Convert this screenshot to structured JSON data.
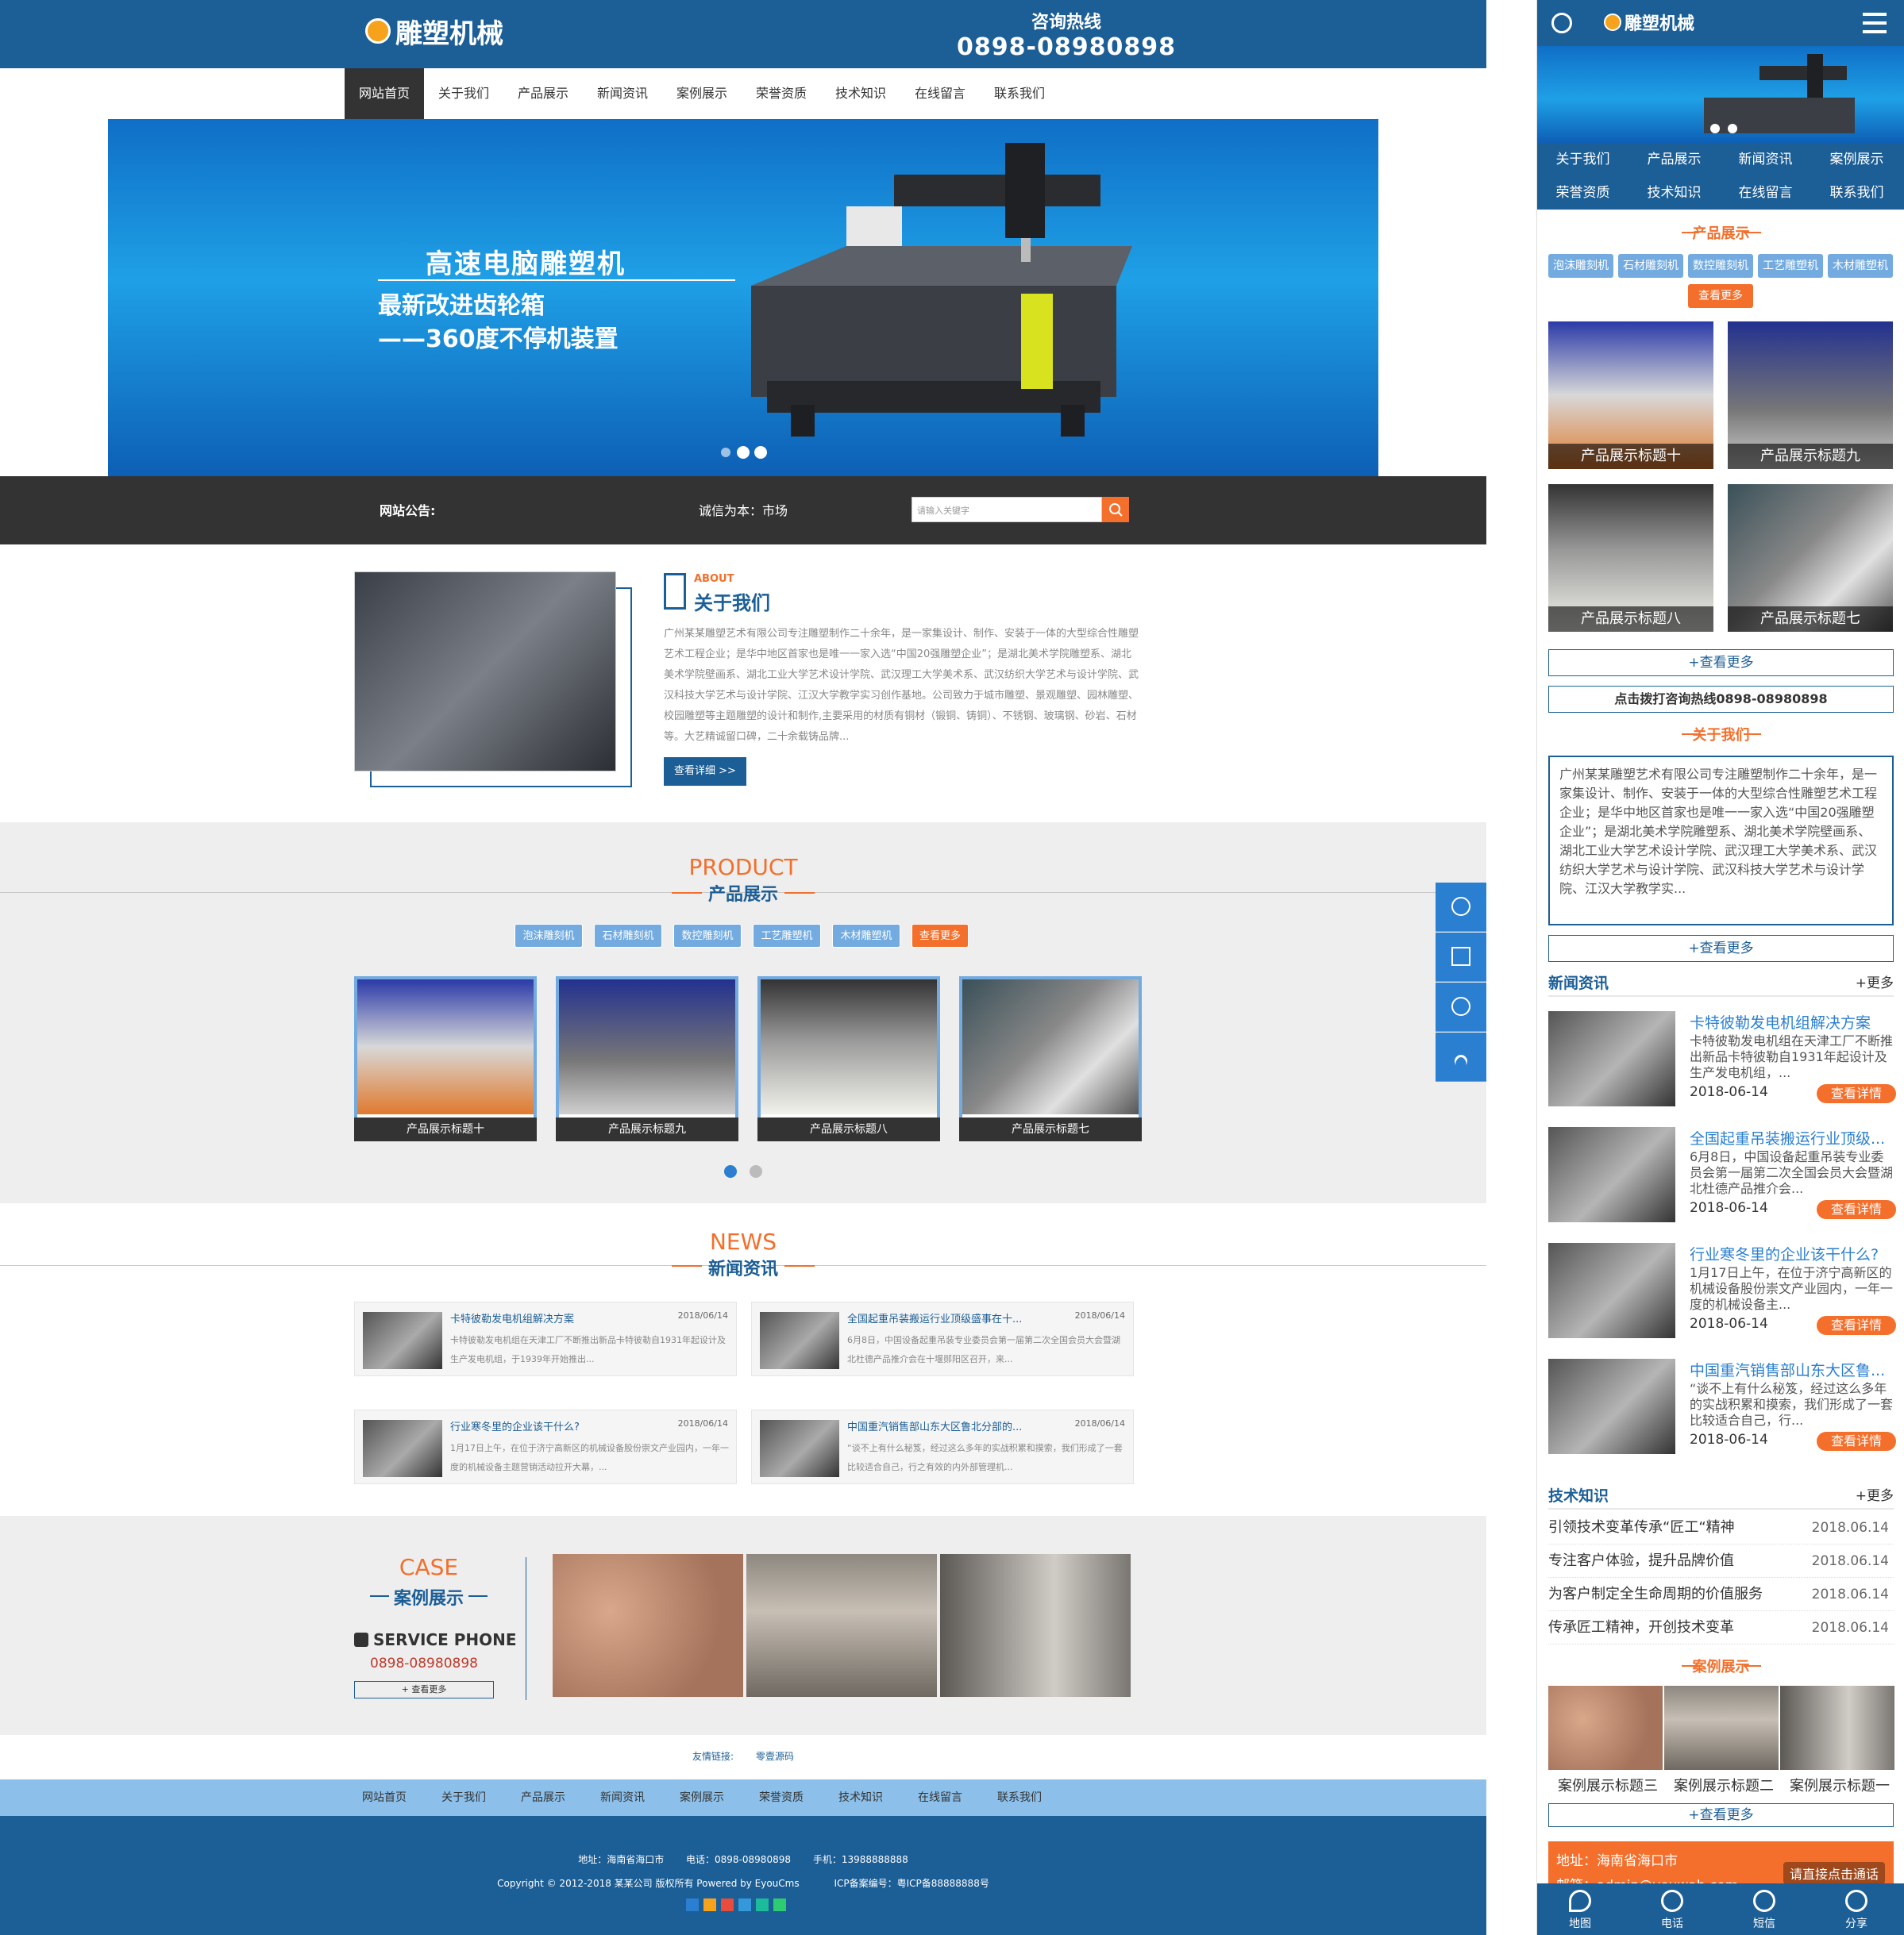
{
  "pc": {
    "logo": "雕塑机械",
    "hotline_label": "咨询热线",
    "hotline_number": "0898-08980898",
    "nav": [
      "网站首页",
      "关于我们",
      "产品展示",
      "新闻资讯",
      "案例展示",
      "荣誉资质",
      "技术知识",
      "在线留言",
      "联系我们"
    ],
    "banner": {
      "title": "高速电脑雕塑机",
      "line1": "最新改进齿轮箱",
      "line2": "——360度不停机装置"
    },
    "notice_label": "网站公告:",
    "notice_text": "诚信为本：市场",
    "search_placeholder": "请输入关键字",
    "about": {
      "en": "ABOUT",
      "cn": "关于我们",
      "text": "广州某某雕塑艺术有限公司专注雕塑制作二十余年，是一家集设计、制作、安装于一体的大型综合性雕塑艺术工程企业；是华中地区首家也是唯一一家入选“中国20强雕塑企业”；是湖北美术学院雕塑系、湖北美术学院壁画系、湖北工业大学艺术设计学院、武汉理工大学美术系、武汉纺织大学艺术与设计学院、武汉科技大学艺术与设计学院、江汉大学教学实习创作基地。公司致力于城市雕塑、景观雕塑、园林雕塑、校园雕塑等主题雕塑的设计和制作,主要采用的材质有铜材（锻铜、铸铜）、不锈钢、玻璃钢、砂岩、石材等。大艺精诚留口碑，二十余载铸品牌...",
      "button": "查看详细 >>"
    },
    "product": {
      "en": "PRODUCT",
      "cn": "产品展示",
      "tags": [
        "泡沫雕刻机",
        "石材雕刻机",
        "数控雕刻机",
        "工艺雕塑机",
        "木材雕塑机"
      ],
      "more": "查看更多",
      "items": [
        "产品展示标题十",
        "产品展示标题九",
        "产品展示标题八",
        "产品展示标题七"
      ]
    },
    "news": {
      "en": "NEWS",
      "cn": "新闻资讯",
      "items": [
        {
          "title": "卡特彼勒发电机组解决方案",
          "date": "2018/06/14",
          "text": "卡特彼勒发电机组在天津工厂不断推出新品卡特彼勒自1931年起设计及生产发电机组，于1939年开始推出..."
        },
        {
          "title": "全国起重吊装搬运行业顶级盛事在十...",
          "date": "2018/06/14",
          "text": "6月8日，中国设备起重吊装专业委员会第一届第二次全国会员大会暨湖北杜德产品推介会在十堰郧阳区召开，来..."
        },
        {
          "title": "行业寒冬里的企业该干什么?",
          "date": "2018/06/14",
          "text": "1月17日上午，在位于济宁高新区的机械设备股份崇文产业园内，一年一度的机械设备主题营销活动拉开大幕，..."
        },
        {
          "title": "中国重汽销售部山东大区鲁北分部的...",
          "date": "2018/06/14",
          "text": "“谈不上有什么秘笈，经过这么多年的实战积累和摸索，我们形成了一套比较适合自己，行之有效的内外部管理机..."
        }
      ]
    },
    "case": {
      "en": "CASE",
      "cn": "案例展示",
      "phone_label": "SERVICE PHONE",
      "phone": "0898-08980898",
      "more": "+ 查看更多"
    },
    "links": {
      "label": "友情链接:",
      "item": "零壹源码"
    },
    "footer_nav": [
      "网站首页",
      "关于我们",
      "产品展示",
      "新闻资讯",
      "案例展示",
      "荣誉资质",
      "技术知识",
      "在线留言",
      "联系我们"
    ],
    "footer": {
      "address": "地址：海南省海口市",
      "tel": "电话：0898-08980898",
      "mobile": "手机：13988888888",
      "copyright": "Copyright © 2012-2018 某某公司 版权所有 Powered by EyouCms",
      "icp": "ICP备案编号：粤ICP备88888888号"
    }
  },
  "mobile": {
    "logo": "雕塑机械",
    "nav": [
      "关于我们",
      "产品展示",
      "新闻资讯",
      "案例展示",
      "荣誉资质",
      "技术知识",
      "在线留言",
      "联系我们"
    ],
    "product_title": "产品展示",
    "tags": [
      "泡沫雕刻机",
      "石材雕刻机",
      "数控雕刻机",
      "工艺雕塑机",
      "木材雕塑机"
    ],
    "more_tag": "查看更多",
    "products": [
      "产品展示标题十",
      "产品展示标题九",
      "产品展示标题八",
      "产品展示标题七"
    ],
    "more_btn": "+查看更多",
    "call_btn": "点击拨打咨询热线0898-08980898",
    "about_title": "关于我们",
    "about_text": "广州某某雕塑艺术有限公司专注雕塑制作二十余年，是一家集设计、制作、安装于一体的大型综合性雕塑艺术工程企业；是华中地区首家也是唯一一家入选“中国20强雕塑企业”；是湖北美术学院雕塑系、湖北美术学院壁画系、湖北工业大学艺术设计学院、武汉理工大学美术系、武汉纺织大学艺术与设计学院、武汉科技大学艺术与设计学院、江汉大学教学实...",
    "news_title": "新闻资讯",
    "more_link": "+更多",
    "detail_btn": "查看详情",
    "news": [
      {
        "title": "卡特彼勒发电机组解决方案",
        "text": "卡特彼勒发电机组在天津工厂不断推出新品卡特彼勒自1931年起设计及生产发电机组，...",
        "date": "2018-06-14"
      },
      {
        "title": "全国起重吊装搬运行业顶级...",
        "text": "6月8日，中国设备起重吊装专业委员会第一届第二次全国会员大会暨湖北杜德产品推介会...",
        "date": "2018-06-14"
      },
      {
        "title": "行业寒冬里的企业该干什么?",
        "text": "1月17日上午，在位于济宁高新区的机械设备股份崇文产业园内，一年一度的机械设备主...",
        "date": "2018-06-14"
      },
      {
        "title": "中国重汽销售部山东大区鲁...",
        "text": "“谈不上有什么秘笈，经过这么多年的实战积累和摸索，我们形成了一套比较适合自己，行...",
        "date": "2018-06-14"
      }
    ],
    "tech_title": "技术知识",
    "tech": [
      {
        "title": "引领技术变革传承“匠工“精神",
        "date": "2018.06.14"
      },
      {
        "title": "专注客户体验，提升品牌价值",
        "date": "2018.06.14"
      },
      {
        "title": "为客户制定全生命周期的价值服务",
        "date": "2018.06.14"
      },
      {
        "title": "传承匠工精神，开创技术变革",
        "date": "2018.06.14"
      }
    ],
    "case_title": "案例展示",
    "cases": [
      "案例展示标题三",
      "案例展示标题二",
      "案例展示标题一"
    ],
    "contact": {
      "address": "地址：海南省海口市",
      "email": "邮箱：admin@youwah.com",
      "float": "请直接点击通话"
    },
    "footer": [
      "地图",
      "电话",
      "短信",
      "分享"
    ]
  },
  "colors": {
    "brand_blue": "#1c5e96",
    "accent_orange": "#f36f2b",
    "tag_blue": "#73abe0",
    "dark": "#333333"
  }
}
